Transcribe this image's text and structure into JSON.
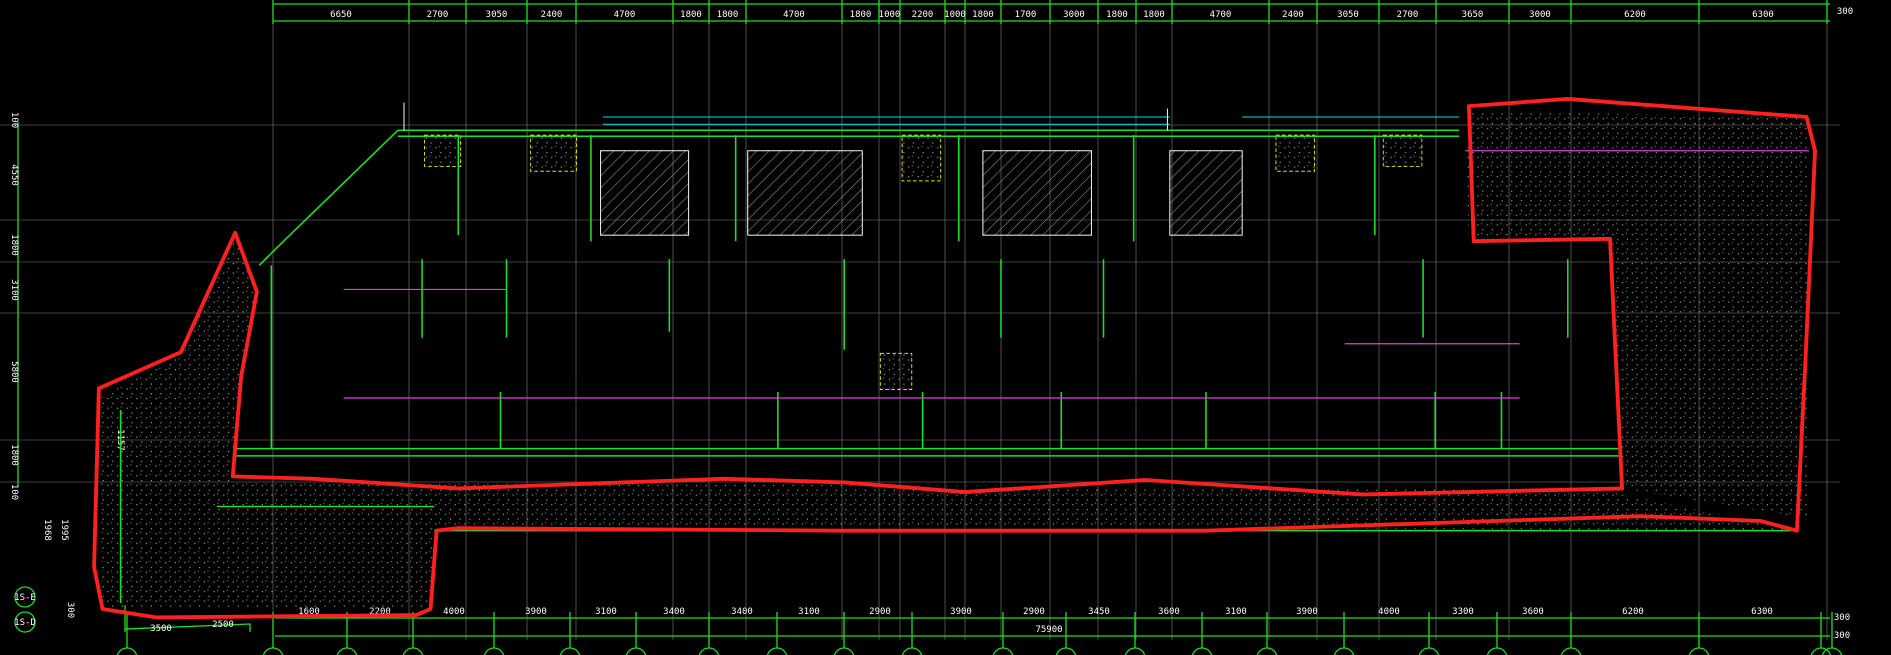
{
  "drawing": {
    "top_dimensions": [
      "6650",
      "2700",
      "3050",
      "2400",
      "4700",
      "1800",
      "1800",
      "4700",
      "1800",
      "1000",
      "2200",
      "1000",
      "1800",
      "1700",
      "3000",
      "1800",
      "1800",
      "4700",
      "2400",
      "3050",
      "2700",
      "3650",
      "3000",
      "6200",
      "6300"
    ],
    "top_right_dimension": "300",
    "bottom_dimensions": [
      "1600",
      "2200",
      "4000",
      "3900",
      "3100",
      "3400",
      "3400",
      "3100",
      "2900",
      "3900",
      "2900",
      "3450",
      "3600",
      "3100",
      "3900",
      "4000",
      "3300",
      "3600",
      "6200",
      "6300"
    ],
    "bottom_left_dimensions": [
      "3500",
      "2500"
    ],
    "bottom_total": "75900",
    "bottom_right_dimensions": [
      "300",
      "300"
    ],
    "left_dimensions": [
      "100",
      "4550",
      "1800",
      "3100",
      "5800",
      "1800",
      "100"
    ],
    "left_extra_dimensions": [
      "1968",
      "1995",
      "300",
      "1157"
    ],
    "axis_labels": [
      "1S-E",
      "1S-D"
    ],
    "colors": {
      "grid": "#1fe01f",
      "outline": "#ff2020",
      "text": "#ffffff",
      "hatch": "#9a9a9a",
      "column": "#e8e000",
      "accent": "#e040e0"
    }
  }
}
